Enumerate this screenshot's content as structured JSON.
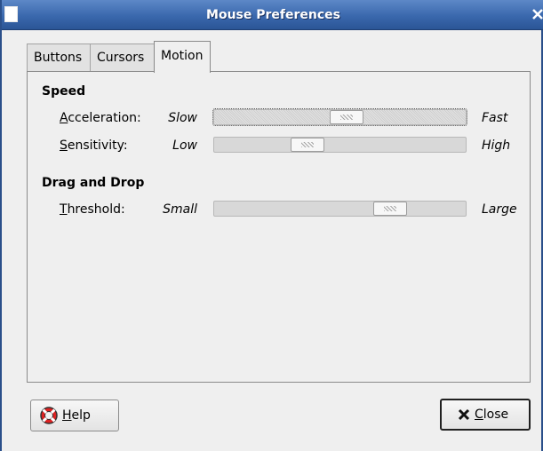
{
  "window": {
    "title": "Mouse Preferences"
  },
  "tabs": [
    {
      "label": "Buttons",
      "active": false
    },
    {
      "label": "Cursors",
      "active": false
    },
    {
      "label": "Motion",
      "active": true
    }
  ],
  "speed": {
    "heading": "Speed",
    "acceleration": {
      "mnemonic": "A",
      "rest": "cceleration:",
      "low": "Slow",
      "high": "Fast",
      "value": 0.53,
      "focused": true
    },
    "sensitivity": {
      "mnemonic": "S",
      "rest": "ensitivity:",
      "low": "Low",
      "high": "High",
      "value": 0.35
    }
  },
  "dragdrop": {
    "heading": "Drag and Drop",
    "threshold": {
      "mnemonic": "T",
      "rest": "hreshold:",
      "low": "Small",
      "high": "Large",
      "value": 0.73
    }
  },
  "buttons": {
    "help": {
      "mnemonic": "H",
      "rest": "elp",
      "icon": "lifebuoy-icon"
    },
    "close": {
      "mnemonic": "C",
      "rest": "lose",
      "icon": "close-x-icon"
    }
  },
  "colors": {
    "titlebar": "#3a68ad",
    "background": "#efefef"
  }
}
